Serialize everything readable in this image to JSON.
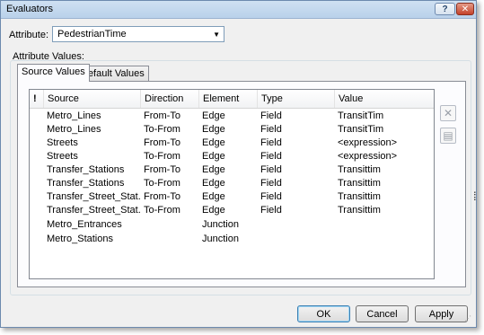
{
  "window": {
    "title": "Evaluators"
  },
  "titlebar": {
    "help_glyph": "?",
    "close_glyph": "✕"
  },
  "attribute": {
    "label": "Attribute:",
    "selected": "PedestrianTime"
  },
  "attribute_values": {
    "caption": "Attribute Values:"
  },
  "tabs": [
    {
      "label": "Source Values",
      "active": true
    },
    {
      "label": "Default Values",
      "active": false
    }
  ],
  "table": {
    "columns": [
      "!",
      "Source",
      "Direction",
      "Element",
      "Type",
      "Value"
    ],
    "rows": [
      {
        "source": "Metro_Lines",
        "direction": "From-To",
        "element": "Edge",
        "type": "Field",
        "value": "TransitTim"
      },
      {
        "source": "Metro_Lines",
        "direction": "To-From",
        "element": "Edge",
        "type": "Field",
        "value": "TransitTim"
      },
      {
        "source": "Streets",
        "direction": "From-To",
        "element": "Edge",
        "type": "Field",
        "value": "<expression>"
      },
      {
        "source": "Streets",
        "direction": "To-From",
        "element": "Edge",
        "type": "Field",
        "value": "<expression>"
      },
      {
        "source": "Transfer_Stations",
        "direction": "From-To",
        "element": "Edge",
        "type": "Field",
        "value": "Transittim"
      },
      {
        "source": "Transfer_Stations",
        "direction": "To-From",
        "element": "Edge",
        "type": "Field",
        "value": "Transittim"
      },
      {
        "source": "Transfer_Street_Stat...",
        "direction": "From-To",
        "element": "Edge",
        "type": "Field",
        "value": "Transittim"
      },
      {
        "source": "Transfer_Street_Stat...",
        "direction": "To-From",
        "element": "Edge",
        "type": "Field",
        "value": "Transittim"
      },
      {
        "source": "Metro_Entrances",
        "direction": "",
        "element": "Junction",
        "type": "",
        "value": ""
      },
      {
        "source": "Metro_Stations",
        "direction": "",
        "element": "Junction",
        "type": "",
        "value": ""
      }
    ]
  },
  "side_buttons": {
    "remove_glyph": "✕",
    "properties_glyph": "▤"
  },
  "buttons": {
    "ok": "OK",
    "cancel": "Cancel",
    "apply": "Apply"
  },
  "colors": {
    "title_bar": "#b9d1ea",
    "close_button": "#c4422a",
    "window_border": "#6d8aae"
  }
}
